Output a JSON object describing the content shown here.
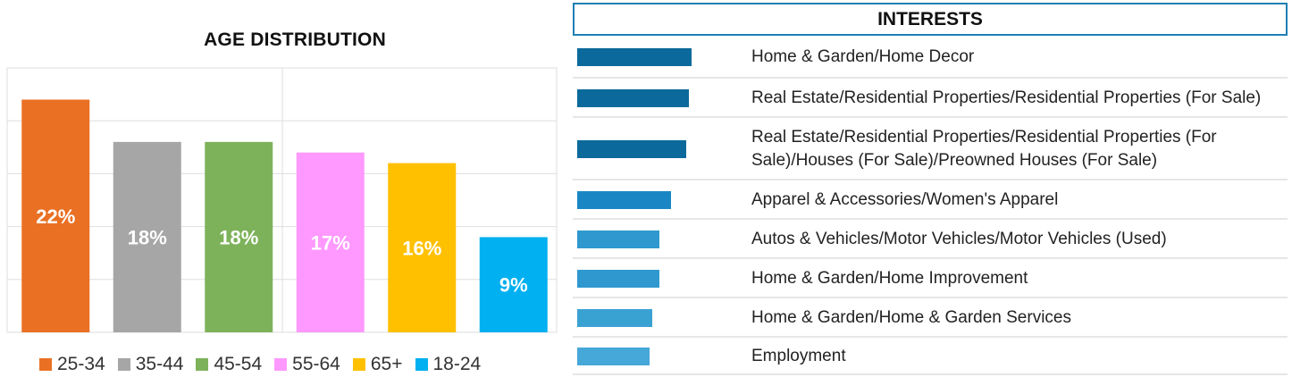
{
  "colors": {
    "grid": "#dedede",
    "interest_dark": "#0b6a9b",
    "interest_mid": "#1a87c4",
    "interest_light": "#2f99cf",
    "interest_lighter": "#45a8d8",
    "header_border": "#1e7fb4"
  },
  "chart_data": [
    {
      "type": "bar",
      "title": "AGE DISTRIBUTION",
      "xlabel": "",
      "ylabel": "",
      "ylim": [
        0,
        25
      ],
      "grid": true,
      "legend_position": "bottom",
      "categories": [
        "25-34",
        "35-44",
        "45-54",
        "55-64",
        "65+",
        "18-24"
      ],
      "values": [
        22,
        18,
        18,
        17,
        16,
        9
      ],
      "data_labels": [
        "22%",
        "18%",
        "18%",
        "17%",
        "16%",
        "9%"
      ],
      "colors": [
        "#ea7024",
        "#a6a6a6",
        "#7db25a",
        "#ff99ff",
        "#ffc000",
        "#00b0f0"
      ]
    },
    {
      "type": "bar",
      "orientation": "horizontal",
      "title": "INTERESTS",
      "categories": [
        "Home & Garden/Home Decor",
        "Real Estate/Residential Properties/Residential Properties (For Sale)",
        "Real Estate/Residential Properties/Residential Properties (For Sale)/Houses (For Sale)/Preowned Houses (For Sale)",
        "Apparel & Accessories/Women's Apparel",
        "Autos & Vehicles/Motor Vehicles/Motor Vehicles (Used)",
        "Home & Garden/Home Improvement",
        "Home & Garden/Home & Garden Services",
        "Employment"
      ],
      "values": [
        100,
        98,
        95,
        82,
        72,
        72,
        66,
        63
      ],
      "colors": [
        "#0b6a9b",
        "#0b6a9b",
        "#0b6a9b",
        "#1a87c4",
        "#2f99cf",
        "#2f99cf",
        "#3aa1d3",
        "#45a8d8"
      ]
    }
  ]
}
